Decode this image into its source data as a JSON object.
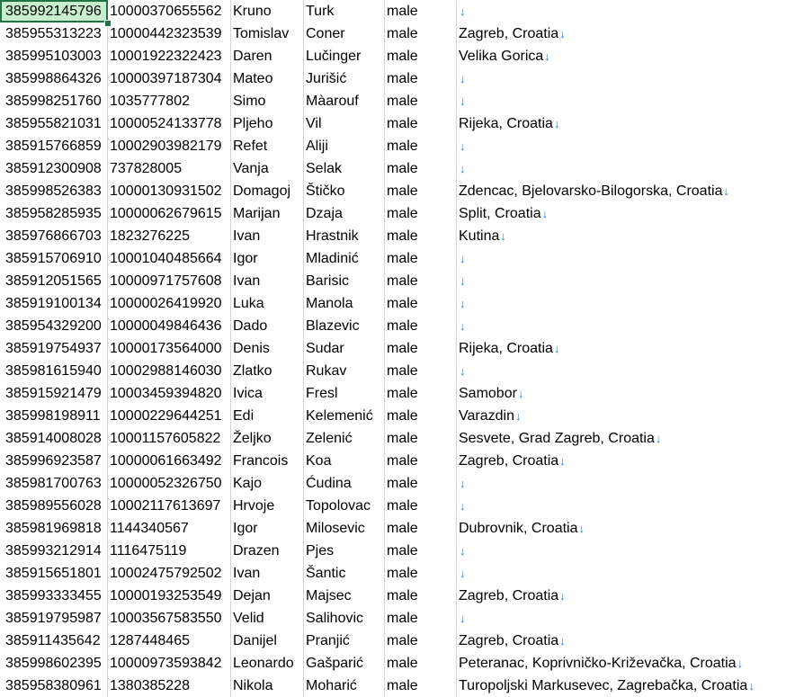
{
  "rows": [
    [
      "385992145796",
      "10000370655562",
      "Kruno",
      "Turk",
      "male",
      ""
    ],
    [
      "385955313223",
      "10000442323539",
      "Tomislav",
      "Coner",
      "male",
      "Zagreb, Croatia"
    ],
    [
      "385995103003",
      "10001922322423",
      "Daren",
      "Lučinger",
      "male",
      "Velika Gorica"
    ],
    [
      "385998864326",
      "10000397187304",
      "Mateo",
      "Jurišić",
      "male",
      ""
    ],
    [
      "385998251760",
      "1035777802",
      "Simo",
      "Màarouf",
      "male",
      ""
    ],
    [
      "385955821031",
      "10000524133778",
      "Pljeho",
      "Vil",
      "male",
      "Rijeka, Croatia"
    ],
    [
      "385915766859",
      "10002903982179",
      "Refet",
      "Aliji",
      "male",
      ""
    ],
    [
      "385912300908",
      "737828005",
      "Vanja",
      "Selak",
      "male",
      ""
    ],
    [
      "385998526383",
      "10000130931502",
      "Domagoj",
      "Štičko",
      "male",
      "Zdencac, Bjelovarsko-Bilogorska, Croatia"
    ],
    [
      "385958285935",
      "10000062679615",
      "Marijan",
      "Dzaja",
      "male",
      "Split, Croatia"
    ],
    [
      "385976866703",
      "1823276225",
      "Ivan",
      "Hrastnik",
      "male",
      "Kutina"
    ],
    [
      "385915706910",
      "10001040485664",
      "Igor",
      "Mladinić",
      "male",
      ""
    ],
    [
      "385912051565",
      "10000971757608",
      "Ivan",
      "Barisic",
      "male",
      ""
    ],
    [
      "385919100134",
      "10000026419920",
      "Luka",
      "Manola",
      "male",
      ""
    ],
    [
      "385954329200",
      "10000049846436",
      "Dado",
      "Blazevic",
      "male",
      ""
    ],
    [
      "385919754937",
      "10000173564000",
      "Denis",
      "Sudar",
      "male",
      "Rijeka, Croatia"
    ],
    [
      "385981615940",
      "10002988146030",
      "Zlatko",
      "Rukav",
      "male",
      ""
    ],
    [
      "385915921479",
      "10003459394820",
      "Ivica",
      "Fresl",
      "male",
      "Samobor"
    ],
    [
      "385998198911",
      "10000229644251",
      "Edi",
      "Kelemenić",
      "male",
      "Varazdin"
    ],
    [
      "385914008028",
      "10001157605822",
      "Željko",
      "Zelenić",
      "male",
      "Sesvete, Grad Zagreb, Croatia"
    ],
    [
      "385996923587",
      "10000061663492",
      "Francois",
      "Koa",
      "male",
      "Zagreb, Croatia"
    ],
    [
      "385981700763",
      "10000052326750",
      "Kajo",
      "Ćudina",
      "male",
      ""
    ],
    [
      "385989556028",
      "10002117613697",
      "Hrvoje",
      "Topolovac",
      "male",
      ""
    ],
    [
      "385981969818",
      "1144340567",
      "Igor",
      "Milosevic",
      "male",
      "Dubrovnik, Croatia"
    ],
    [
      "385993212914",
      "1116475119",
      "Drazen",
      "Pjes",
      "male",
      ""
    ],
    [
      "385915651801",
      "10002475792502",
      "Ivan",
      "Šantic",
      "male",
      ""
    ],
    [
      "385993333455",
      "10000193253549",
      "Dejan",
      "Majsec",
      "male",
      "Zagreb, Croatia"
    ],
    [
      "385919795987",
      "10003567583550",
      "Velid",
      "Salihovic",
      "male",
      ""
    ],
    [
      "385911435642",
      "1287448465",
      "Danijel",
      "Pranjić",
      "male",
      "Zagreb, Croatia"
    ],
    [
      "385998602395",
      "10000973593842",
      "Leonardo",
      "Gašparić",
      "male",
      "Peteranac,  Koprivničko-Križevačka, Croatia"
    ],
    [
      "385958380961",
      "1380385228",
      "Nikola",
      "Moharić",
      "male",
      "Turopoljski Markusevec, Zagrebačka, Croatia"
    ]
  ],
  "line_break_glyph": "↓",
  "selected_cell": "A1",
  "colors": {
    "selection_fill": "#c6efce",
    "selection_border": "#217346",
    "arrow": "#2a7be4"
  }
}
